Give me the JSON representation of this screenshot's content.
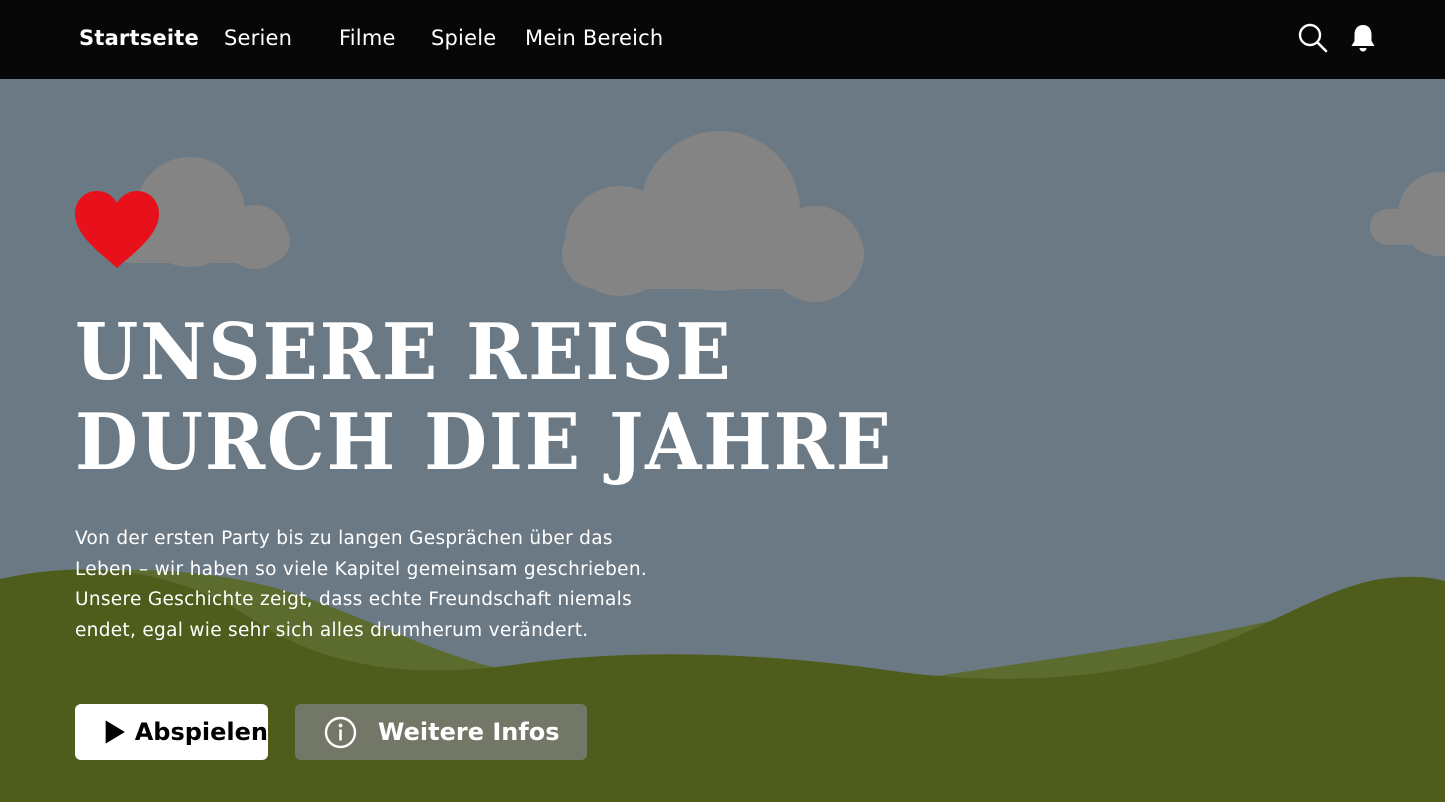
{
  "nav": {
    "items": [
      {
        "label": "Startseite",
        "active": true
      },
      {
        "label": "Serien",
        "active": false
      },
      {
        "label": "Filme",
        "active": false
      },
      {
        "label": "Spiele",
        "active": false
      },
      {
        "label": "Mein Bereich",
        "active": false
      }
    ],
    "icons": [
      "search-icon",
      "bell-icon"
    ]
  },
  "hero": {
    "logo_icon": "heart-icon",
    "title_line1": "UNSERE REISE",
    "title_line2": "DURCH DIE JAHRE",
    "description": "Von der ersten Party bis zu langen Gesprächen über das Leben – wir haben so viele Kapitel gemeinsam geschrieben. Unsere Geschichte zeigt, dass echte Freundschaft niemals endet, egal wie sehr sich alles drumherum verändert.",
    "play_button": {
      "label": "Abspielen",
      "icon": "play-icon"
    },
    "info_button": {
      "label": "Weitere Infos",
      "icon": "info-icon"
    }
  },
  "colors": {
    "nav_background": "#070707",
    "sky": "#6b7984",
    "hill": "#4e5d1c",
    "heart": "#e8101a",
    "play_button_bg": "#ffffff",
    "info_button_bg": "#808080"
  }
}
